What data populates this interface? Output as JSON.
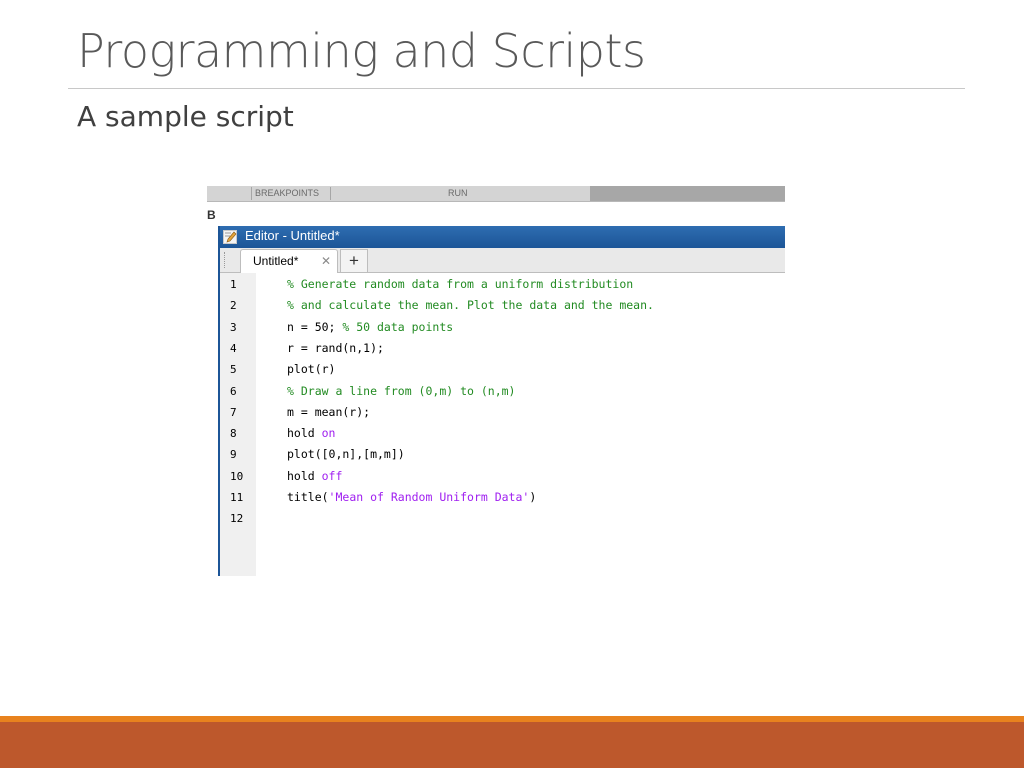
{
  "slide": {
    "title": "Programming and Scripts",
    "subtitle": "A sample script"
  },
  "toolstrip": {
    "breakpoints_label": "BREAKPOINTS",
    "run_label": "RUN",
    "side_letter": "B"
  },
  "editor": {
    "title": "Editor - Untitled*",
    "tab_label": "Untitled*",
    "tab_close_glyph": "✕",
    "tab_add_glyph": "+",
    "icon": "editor-pencil-icon"
  },
  "code_lines": [
    {
      "n": "1",
      "tokens": [
        {
          "t": "% Generate random data from a uniform distribution",
          "k": "comment"
        }
      ]
    },
    {
      "n": "2",
      "tokens": [
        {
          "t": "% and calculate the mean. Plot the data and the mean.",
          "k": "comment"
        }
      ]
    },
    {
      "n": "3",
      "tokens": [
        {
          "t": "n = 50; ",
          "k": "plain"
        },
        {
          "t": "% 50 data points",
          "k": "comment"
        }
      ]
    },
    {
      "n": "4",
      "tokens": [
        {
          "t": "r = rand(n,1);",
          "k": "plain"
        }
      ]
    },
    {
      "n": "5",
      "tokens": [
        {
          "t": "plot(r)",
          "k": "plain"
        }
      ]
    },
    {
      "n": "6",
      "tokens": [
        {
          "t": "% Draw a line from (0,m) to (n,m)",
          "k": "comment"
        }
      ]
    },
    {
      "n": "7",
      "tokens": [
        {
          "t": "m = mean(r);",
          "k": "plain"
        }
      ]
    },
    {
      "n": "8",
      "tokens": [
        {
          "t": "hold ",
          "k": "plain"
        },
        {
          "t": "on",
          "k": "keyword"
        }
      ]
    },
    {
      "n": "9",
      "tokens": [
        {
          "t": "plot([0,n],[m,m])",
          "k": "plain"
        }
      ]
    },
    {
      "n": "10",
      "tokens": [
        {
          "t": "hold ",
          "k": "plain"
        },
        {
          "t": "off",
          "k": "keyword"
        }
      ]
    },
    {
      "n": "11",
      "tokens": [
        {
          "t": "title(",
          "k": "plain"
        },
        {
          "t": "'Mean of Random Uniform Data'",
          "k": "string"
        },
        {
          "t": ")",
          "k": "plain"
        }
      ]
    },
    {
      "n": "12",
      "tokens": []
    }
  ],
  "colors": {
    "comment": "#228b22",
    "keyword": "#a020f0",
    "string": "#a020f0",
    "editor_titlebar": "#1c5597",
    "footer_accent": "#e8821e",
    "footer_band": "#bd582c"
  }
}
